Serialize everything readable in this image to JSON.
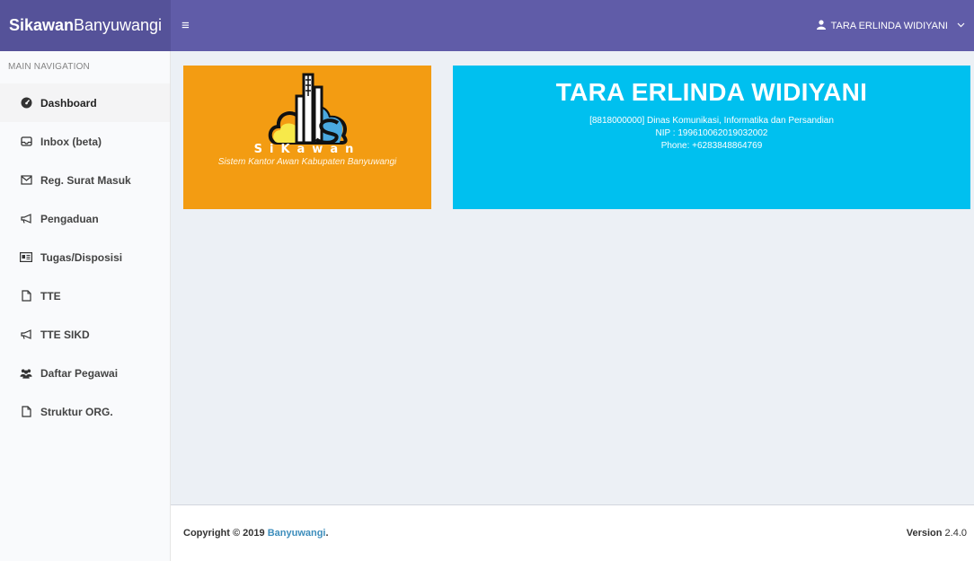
{
  "header": {
    "logo_bold": "Sikawan",
    "logo_rest": "Banyuwangi",
    "menu_toggle": "≡",
    "user_name": "TARA ERLINDA WIDIYANI",
    "user_icon": "user-icon",
    "colors": {
      "header_bg": "#605ca8",
      "logo_bg": "#555299"
    }
  },
  "sidebar": {
    "header": "MAIN NAVIGATION",
    "items": [
      {
        "label": "Dashboard",
        "icon": "dashboard-icon",
        "active": true
      },
      {
        "label": "Inbox (beta)",
        "icon": "inbox-icon"
      },
      {
        "label": "Reg. Surat Masuk",
        "icon": "envelope-icon"
      },
      {
        "label": "Pengaduan",
        "icon": "bullhorn-icon"
      },
      {
        "label": "Tugas/Disposisi",
        "icon": "id-card-icon"
      },
      {
        "label": "TTE",
        "icon": "file-icon"
      },
      {
        "label": "TTE SIKD",
        "icon": "bullhorn-icon"
      },
      {
        "label": "Daftar Pegawai",
        "icon": "users-icon"
      },
      {
        "label": "Struktur ORG.",
        "icon": "file-icon"
      }
    ]
  },
  "logo_box": {
    "name": "SiKawan",
    "subtitle": "Sistem Kantor Awan Kabupaten Banyuwangi",
    "color": "#f39c12"
  },
  "profile": {
    "name": "TARA ERLINDA WIDIYANI",
    "unit": "[8818000000] Dinas Komunikasi, Informatika dan Persandian",
    "nip": "NIP : 199610062019032002",
    "phone": "Phone: +6283848864769",
    "color": "#00c0ef"
  },
  "footer": {
    "copyright": "Copyright © 2019",
    "link": "Banyuwangi",
    "period": ".",
    "version_label": "Version",
    "version": "2.4.0",
    "link_color": "#3c8dbc"
  }
}
